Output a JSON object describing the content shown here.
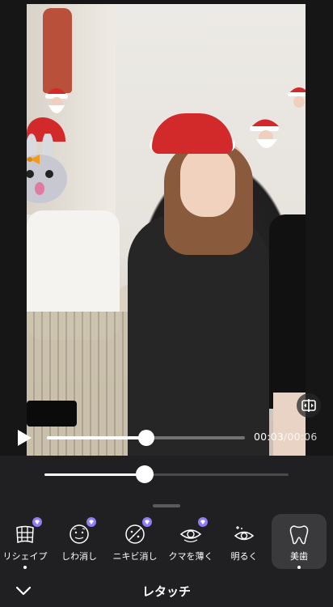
{
  "player": {
    "time_current": "00:03",
    "time_total": "00:06",
    "progress_fraction": 0.5
  },
  "intensity": {
    "value_fraction": 0.41
  },
  "tools": [
    {
      "label": "リシェイプ",
      "icon": "reshape-grid-icon",
      "premium": true,
      "active": false,
      "dot": true
    },
    {
      "label": "しわ消し",
      "icon": "wrinkle-face-icon",
      "premium": true,
      "active": false,
      "dot": false
    },
    {
      "label": "ニキビ消し",
      "icon": "acne-remove-icon",
      "premium": true,
      "active": false,
      "dot": false
    },
    {
      "label": "クマを薄く",
      "icon": "dark-circle-eye-icon",
      "premium": true,
      "active": false,
      "dot": false
    },
    {
      "label": "明るく",
      "icon": "brighten-eye-icon",
      "premium": false,
      "active": false,
      "dot": false
    },
    {
      "label": "美歯",
      "icon": "tooth-icon",
      "premium": false,
      "active": true,
      "dot": true
    }
  ],
  "bottom_bar": {
    "title": "レタッチ"
  },
  "colors": {
    "panel_bg": "#202022",
    "active_tile": "#3a3a3c",
    "premium_badge": "#8f7cf7"
  }
}
